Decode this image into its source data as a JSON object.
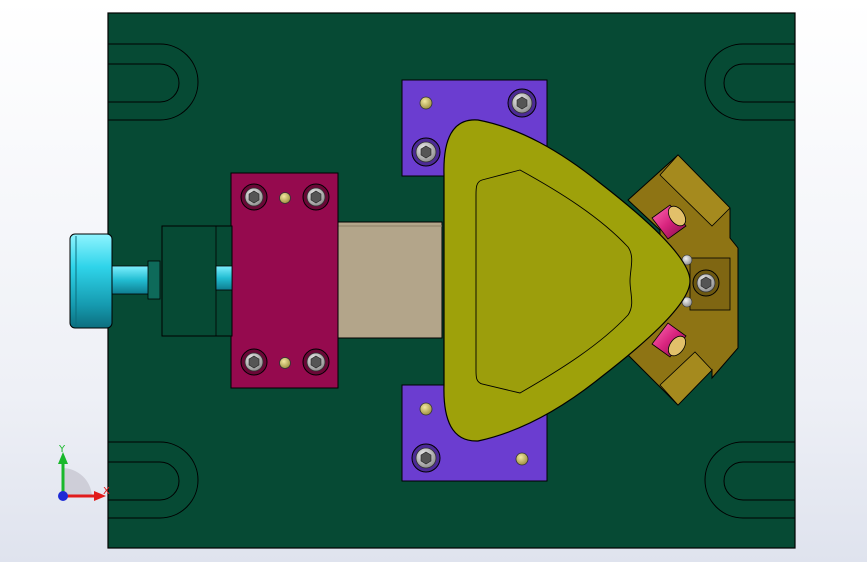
{
  "viewport": {
    "background_top": "#ffffff",
    "background_bottom": "#dfe3ee"
  },
  "colors": {
    "base_plate": "#064a34",
    "purple_block": "#6b3dd0",
    "magenta_block": "#950a4e",
    "yellow_cam": "#9ea10a",
    "olive_holder": "#8e7414",
    "tan_slide": "#b3a58a",
    "cyan_knob": "#2fd4ea",
    "pink_pin": "#d8247e",
    "axis_x": "#e11b1b",
    "axis_y": "#19b82b",
    "axis_z": "#1d2bd6"
  },
  "triad": {
    "x_label": "X",
    "y_label": "Y"
  },
  "icons": {
    "coordinate_triad": "axis-triad-icon",
    "socket_screw": "hex-socket-screw-icon",
    "dowel_pin": "dowel-pin-icon"
  }
}
